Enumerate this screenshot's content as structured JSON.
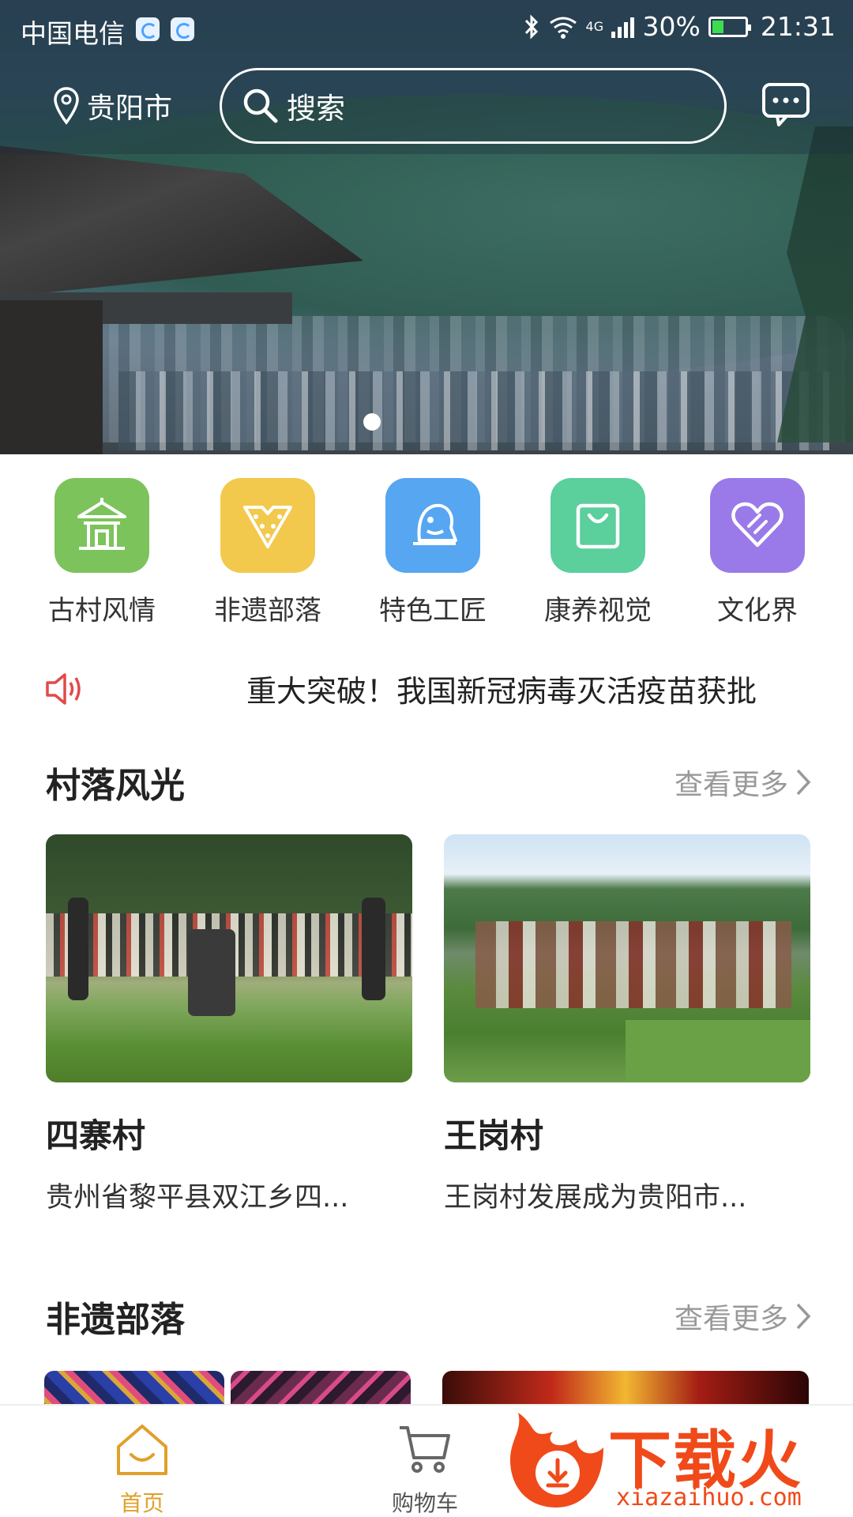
{
  "status_bar": {
    "carrier": "中国电信",
    "battery": "30%",
    "time": "21:31",
    "network": "4G"
  },
  "header": {
    "location": "贵阳市",
    "search_placeholder": "搜索"
  },
  "categories": [
    {
      "label": "古村风情",
      "icon": "pavilion-icon",
      "color": "#7cc35c"
    },
    {
      "label": "非遗部落",
      "icon": "necklace-icon",
      "color": "#f2c94c"
    },
    {
      "label": "特色工匠",
      "icon": "bell-icon",
      "color": "#56a6f2"
    },
    {
      "label": "康养视觉",
      "icon": "bag-icon",
      "color": "#5bcf9c"
    },
    {
      "label": "文化界",
      "icon": "heart-icon",
      "color": "#9a7ae8"
    }
  ],
  "notice": {
    "text": "重大突破！我国新冠病毒灭活疫苗获批"
  },
  "sections": {
    "village": {
      "title": "村落风光",
      "more": "查看更多"
    },
    "heritage": {
      "title": "非遗部落",
      "more": "查看更多"
    }
  },
  "village_cards": [
    {
      "name": "四寨村",
      "desc": "贵州省黎平县双江乡四..."
    },
    {
      "name": "王岗村",
      "desc": "王岗村发展成为贵阳市..."
    }
  ],
  "tabs": {
    "home": "首页",
    "cart": "购物车"
  },
  "watermark": {
    "brand": "下载火",
    "url": "xiazaihuo.com"
  },
  "colors": {
    "accent": "#e0a02a",
    "watermark": "#f04a1a"
  }
}
